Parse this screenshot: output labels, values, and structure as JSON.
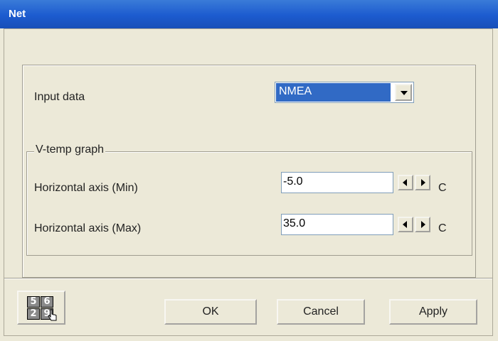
{
  "window": {
    "title": "Net"
  },
  "input_data": {
    "label": "Input data",
    "selected": "NMEA"
  },
  "vtemp_group": {
    "legend": "V-temp graph",
    "rows": [
      {
        "label": "Horizontal axis (Min)",
        "value": "-5.0",
        "unit": "C"
      },
      {
        "label": "Horizontal axis (Max)",
        "value": "35.0",
        "unit": "C"
      }
    ]
  },
  "keypad_icon": {
    "digits": [
      "5",
      "6",
      "2",
      "9"
    ]
  },
  "buttons": {
    "ok": "OK",
    "cancel": "Cancel",
    "apply": "Apply"
  },
  "colors": {
    "titlebar": "#1c5bcf",
    "selection": "#316ac5",
    "face": "#ece9d8"
  }
}
